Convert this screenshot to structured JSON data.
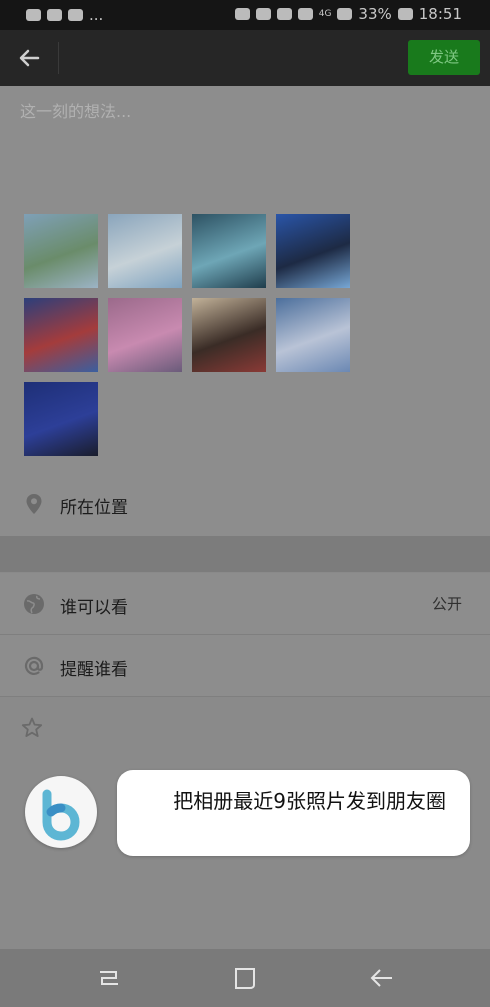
{
  "status_bar": {
    "ellipsis": "...",
    "network": "4G",
    "battery": "33%",
    "time": "18:51"
  },
  "header": {
    "send_label": "发送"
  },
  "compose": {
    "placeholder": "这一刻的想法..."
  },
  "photos": {
    "count": 9,
    "items": [
      {
        "name": "landscape-sky",
        "colors": [
          "#7fa0b7",
          "#6a8c6a",
          "#9cb3c5"
        ]
      },
      {
        "name": "event-stage-blue",
        "colors": [
          "#8aa5bc",
          "#c6d1d7",
          "#7fa3c0"
        ]
      },
      {
        "name": "dancer-teal",
        "colors": [
          "#2d5263",
          "#6ea6b6",
          "#1f3d4c"
        ]
      },
      {
        "name": "man-portrait-blue",
        "colors": [
          "#2a55a8",
          "#1d2a44",
          "#77a7d5"
        ]
      },
      {
        "name": "performers-red",
        "colors": [
          "#2c3f7b",
          "#a43c3c",
          "#3b5fa0"
        ]
      },
      {
        "name": "dancers-stage-pink",
        "colors": [
          "#9b6a8b",
          "#c88ab0",
          "#6a5b7a"
        ]
      },
      {
        "name": "group-photo",
        "colors": [
          "#c2b299",
          "#3a2c26",
          "#8a3a36"
        ]
      },
      {
        "name": "dancer-white-stage",
        "colors": [
          "#4c6f9c",
          "#b9c3d6",
          "#6b88b3"
        ]
      },
      {
        "name": "speaker-blue",
        "colors": [
          "#1e2f77",
          "#2d3f98",
          "#1a1d2c"
        ]
      }
    ]
  },
  "location": {
    "label": "所在位置",
    "icon": "location-pin-icon"
  },
  "visibility": {
    "label": "谁可以看",
    "value": "公开",
    "icon": "globe-icon"
  },
  "mention": {
    "label": "提醒谁看",
    "icon": "at-icon"
  },
  "extra": {
    "icon": "star-icon"
  },
  "assistant": {
    "message": "把相册最近9张照片发到朋友圈",
    "icon": "bixby-icon"
  },
  "navigation": {
    "recent": "recent-apps-icon",
    "home": "home-icon",
    "back": "back-icon"
  },
  "colors": {
    "send_button": "#197a1c",
    "topbar": "#262626",
    "overlay_bg": "#8d8d8d"
  }
}
